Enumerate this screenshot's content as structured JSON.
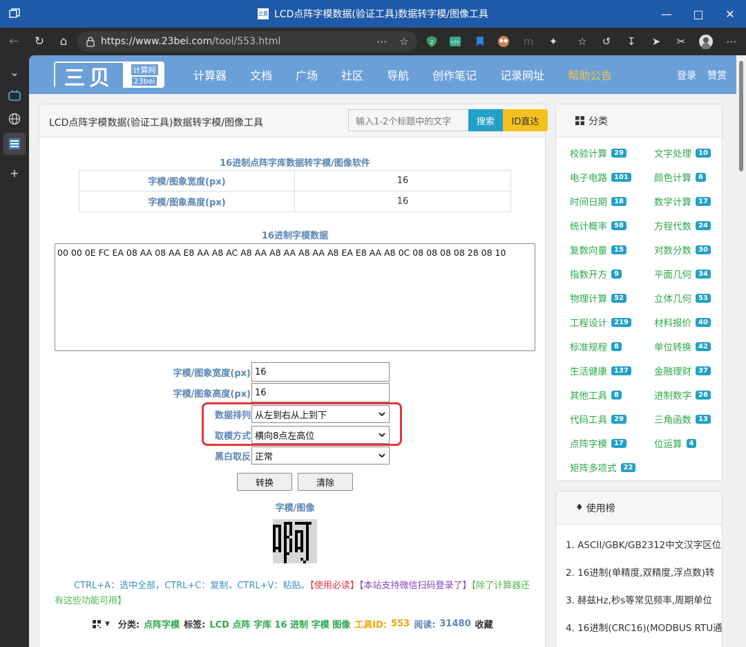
{
  "window": {
    "title": "LCD点阵字模数据(验证工具)数据转字模/图像工具",
    "favicon_text": "三贝"
  },
  "browser": {
    "url_host": "https://www.23bei.com",
    "url_path": "/tool/553.html",
    "ext_badge": "2"
  },
  "site": {
    "logo_big": "三贝",
    "logo_small_top": "计算网",
    "logo_small_bottom": "23bei",
    "menu": [
      "计算器",
      "文档",
      "广场",
      "社区",
      "导航",
      "创作笔记",
      "记录网址",
      "帮助公告"
    ],
    "login": "登录",
    "praise": "赞赏"
  },
  "main": {
    "page_title": "LCD点阵字模数据(验证工具)数据转字模/图像工具",
    "search_placeholder": "输入1-2个标题中的文字",
    "search_btn": "搜索",
    "id_btn": "ID直达",
    "table_title": "16进制点阵字库数据转字模/图像软件",
    "table": [
      {
        "k": "字模/图象宽度(px)",
        "v": "16"
      },
      {
        "k": "字模/图象高度(px)",
        "v": "16"
      }
    ],
    "hex_title": "16进制字模数据",
    "hex_data": "00 00 0E FC EA 08 AA 08 AA E8 AA A8 AC A8 AA A8 AA A8 AA A8 EA E8 AA A8 0C 08 08 08 08 28 08 10",
    "form": {
      "width_label": "字模/图象宽度(px)",
      "width_value": "16",
      "height_label": "字模/图象高度(px)",
      "height_value": "16",
      "order_label": "数据排列",
      "order_value": "从左到右从上到下",
      "mode_label": "取模方式",
      "mode_value": "横向8点左高位",
      "invert_label": "黑白取反",
      "invert_value": "正常"
    },
    "convert_btn": "转换",
    "clear_btn": "清除",
    "image_title": "字模/图像",
    "tip1": "CTRL+A：选中全部，CTRL+C：复制，CTRL+V：粘贴。",
    "tip2": "【使用必读】",
    "tip3": "【本站支持微信扫码登录了】",
    "tip4": "【除了计算器还有这些功能可用】",
    "meta": {
      "cat_label": "分类:",
      "cat_value": "点阵字模",
      "tag_label": "标签:",
      "tags": "LCD 点阵 字库 16 进制 字模 图像",
      "id_label": "工具ID:",
      "id_value": "553",
      "read_label": "阅读:",
      "read_value": "31480",
      "fav": "收藏"
    }
  },
  "categories": {
    "title": "分类",
    "items": [
      {
        "name": "校验计算",
        "count": "29"
      },
      {
        "name": "文字处理",
        "count": "10"
      },
      {
        "name": "电子电路",
        "count": "101"
      },
      {
        "name": "颜色计算",
        "count": "6"
      },
      {
        "name": "时间日期",
        "count": "18"
      },
      {
        "name": "数学计算",
        "count": "17"
      },
      {
        "name": "统计概率",
        "count": "58"
      },
      {
        "name": "方程代数",
        "count": "24"
      },
      {
        "name": "复数向量",
        "count": "15"
      },
      {
        "name": "对数分数",
        "count": "30"
      },
      {
        "name": "指数开方",
        "count": "9"
      },
      {
        "name": "平面几何",
        "count": "34"
      },
      {
        "name": "物理计算",
        "count": "52"
      },
      {
        "name": "立体几何",
        "count": "53"
      },
      {
        "name": "工程设计",
        "count": "219"
      },
      {
        "name": "材料报价",
        "count": "40"
      },
      {
        "name": "标准规程",
        "count": "8"
      },
      {
        "name": "单位转换",
        "count": "42"
      },
      {
        "name": "生活健康",
        "count": "137"
      },
      {
        "name": "金融理财",
        "count": "37"
      },
      {
        "name": "其他工具",
        "count": "8"
      },
      {
        "name": "进制数字",
        "count": "26"
      },
      {
        "name": "代码工具",
        "count": "29"
      },
      {
        "name": "三角函数",
        "count": "13"
      },
      {
        "name": "点阵字模",
        "count": "17"
      },
      {
        "name": "位运算",
        "count": "4"
      },
      {
        "name": "矩阵多项式",
        "count": "22"
      }
    ]
  },
  "ranking": {
    "title": "使用榜",
    "items": [
      "1. ASCII/GBK/GB2312中文汉字区位",
      "2. 16进制(单精度,双精度,浮点数)转",
      "3. 赫兹Hz,秒s等常见频率,周期单位",
      "4. 16进制(CRC16)(MODBUS RTU通"
    ]
  }
}
